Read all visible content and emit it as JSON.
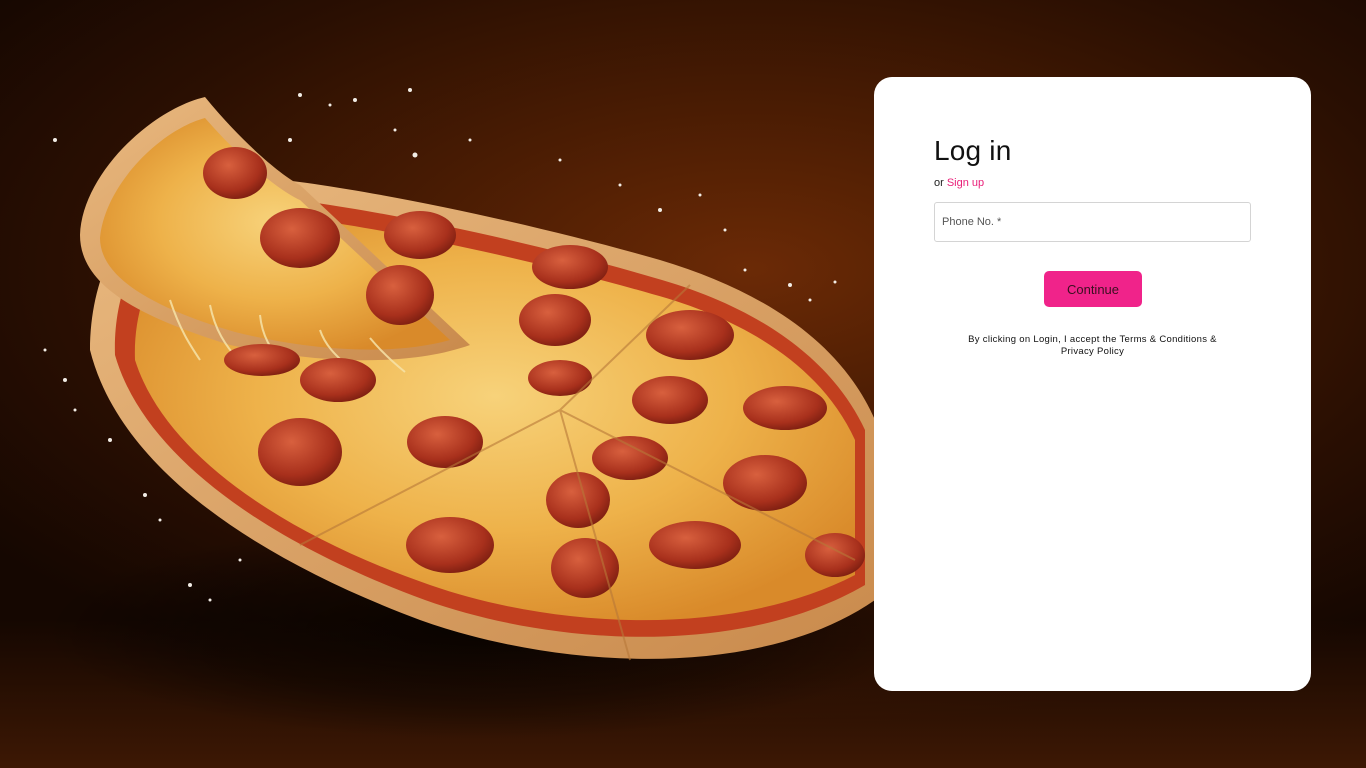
{
  "login": {
    "title": "Log in",
    "signup_prefix": "or",
    "signup_link": "Sign up",
    "phone_placeholder": "Phone No. *",
    "continue_label": "Continue",
    "terms_line1": "By clicking on Login, I accept the Terms & Conditions &",
    "terms_line2": "Privacy Policy"
  },
  "colors": {
    "accent": "#f0238a",
    "link": "#e91e78",
    "background": "#3a1603",
    "card": "#ffffff"
  },
  "hero": {
    "icon": "pizza-image"
  }
}
